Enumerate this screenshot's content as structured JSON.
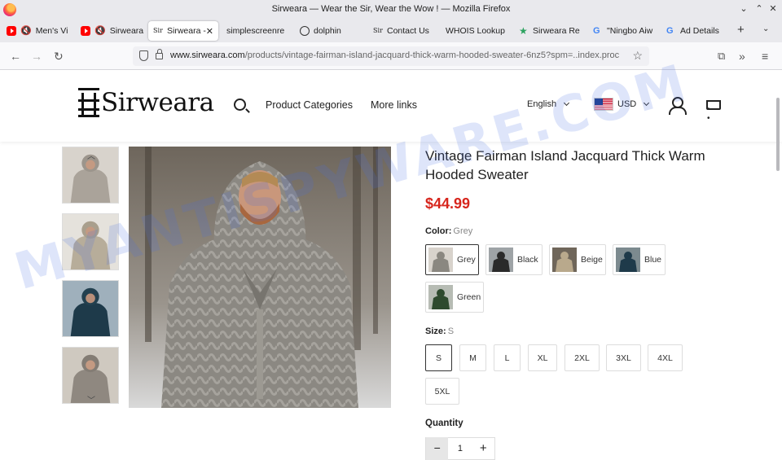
{
  "window": {
    "title": "Sirweara — Wear the Sir, Wear the Wow ! — Mozilla Firefox"
  },
  "tabs": [
    {
      "label": "Men's Vi",
      "icon": "youtube-icon",
      "muted": true
    },
    {
      "label": "Sirweara",
      "icon": "youtube-icon",
      "muted": true
    },
    {
      "label": "Sirweara -",
      "icon": "sirweara-favicon",
      "active": true
    },
    {
      "label": "simplescreenre",
      "icon": ""
    },
    {
      "label": "dolphin",
      "icon": "globe-icon"
    },
    {
      "label": "Contact Us",
      "icon": "sirweara-favicon"
    },
    {
      "label": "WHOIS Lookup",
      "icon": ""
    },
    {
      "label": "Sirweara Re",
      "icon": "star-icon"
    },
    {
      "label": "\"Ningbo Aiw",
      "icon": "google-icon"
    },
    {
      "label": "Ad Details",
      "icon": "google-icon"
    }
  ],
  "address": {
    "host": "www.sirweara.com",
    "path": "/products/vintage-fairman-island-jacquard-thick-warm-hooded-sweater-6nz5?spm=..index.proc"
  },
  "site": {
    "logo_text": "Sirweara",
    "nav": [
      "Product Categories",
      "More links"
    ],
    "language": "English",
    "currency": "USD"
  },
  "product": {
    "title": "Vintage Fairman Island Jacquard Thick Warm Hooded Sweater",
    "price": "$44.99",
    "color_label": "Color:",
    "color_selected": "Grey",
    "colors": [
      "Grey",
      "Black",
      "Beige",
      "Blue",
      "Green"
    ],
    "size_label": "Size:",
    "size_selected": "S",
    "sizes": [
      "S",
      "M",
      "L",
      "XL",
      "2XL",
      "3XL",
      "4XL",
      "5XL"
    ],
    "quantity_label": "Quantity",
    "quantity": "1"
  },
  "watermark": "MYANTISPYWARE.COM",
  "colors": {
    "price": "#d7261d",
    "watermark": "rgba(70,110,230,0.18)",
    "grey_sweater": "#8a8780",
    "black_sweater": "#2a2a2a",
    "beige_sweater": "#b9a98c",
    "blue_sweater": "#1e3a4a",
    "green_sweater": "#2e4a2e"
  }
}
